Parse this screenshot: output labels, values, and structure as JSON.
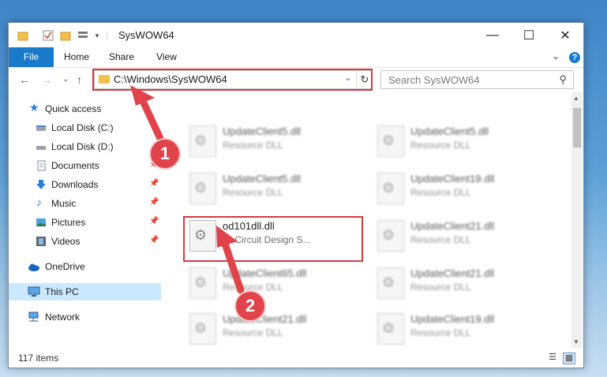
{
  "window": {
    "title": "SysWOW64",
    "controls": {
      "minimize": "—",
      "maximize": "☐",
      "close": "✕"
    }
  },
  "ribbon": {
    "tabs": [
      "File",
      "Home",
      "Share",
      "View"
    ],
    "help": "?",
    "collapse": "⌄"
  },
  "nav": {
    "back": "←",
    "forward": "→",
    "recent": "⌄",
    "up": "↑",
    "address": "C:\\Windows\\SysWOW64",
    "search_placeholder": "Search SysWOW64"
  },
  "sidebar": {
    "quick_access": "Quick access",
    "items": [
      {
        "label": "Local Disk (C:)",
        "icon": "drive-icon"
      },
      {
        "label": "Local Disk (D:)",
        "icon": "drive-icon"
      },
      {
        "label": "Documents",
        "icon": "documents-icon"
      },
      {
        "label": "Downloads",
        "icon": "download-icon"
      },
      {
        "label": "Music",
        "icon": "music-icon"
      },
      {
        "label": "Pictures",
        "icon": "pictures-icon"
      },
      {
        "label": "Videos",
        "icon": "videos-icon"
      }
    ],
    "onedrive": "OneDrive",
    "this_pc": "This PC",
    "network": "Network"
  },
  "files": [
    {
      "name": "UpdateClient5.dll",
      "desc": "Resource DLL"
    },
    {
      "name": "UpdateClient5.dll",
      "desc": "Resource DLL"
    },
    {
      "name": "UpdateClient5.dll",
      "desc": "Resource DLL"
    },
    {
      "name": "UpdateClient19.dll",
      "desc": "Resource DLL"
    },
    {
      "name": "od101dll.dll",
      "desc": "NI Circuit Design S..."
    },
    {
      "name": "UpdateClient21.dll",
      "desc": "Resource DLL"
    },
    {
      "name": "UpdateClient65.dll",
      "desc": "Resource DLL"
    },
    {
      "name": "UpdateClient21.dll",
      "desc": "Resource DLL"
    },
    {
      "name": "UpdateClient21.dll",
      "desc": "Resource DLL"
    },
    {
      "name": "UpdateClient19.dll",
      "desc": "Resource DLL"
    }
  ],
  "status": {
    "count": "117 items"
  },
  "callouts": {
    "one": "1",
    "two": "2"
  },
  "colors": {
    "accent": "#1979ca",
    "highlight": "#d6393d",
    "callout": "#e0434a",
    "selected": "#cce8ff"
  }
}
